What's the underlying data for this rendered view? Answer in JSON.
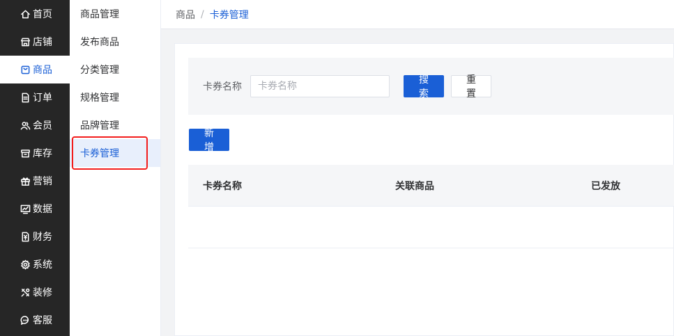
{
  "nav": {
    "items": [
      {
        "label": "首页",
        "icon": "home-icon"
      },
      {
        "label": "店铺",
        "icon": "store-icon"
      },
      {
        "label": "商品",
        "icon": "bag-icon"
      },
      {
        "label": "订单",
        "icon": "document-icon"
      },
      {
        "label": "会员",
        "icon": "users-icon"
      },
      {
        "label": "库存",
        "icon": "box-icon"
      },
      {
        "label": "营销",
        "icon": "gift-icon"
      },
      {
        "label": "数据",
        "icon": "chart-icon"
      },
      {
        "label": "财务",
        "icon": "yen-icon"
      },
      {
        "label": "系统",
        "icon": "gear-icon"
      },
      {
        "label": "装修",
        "icon": "brush-icon"
      },
      {
        "label": "客服",
        "icon": "chat-icon"
      }
    ],
    "active_index": 2
  },
  "subnav": {
    "items": [
      "商品管理",
      "发布商品",
      "分类管理",
      "规格管理",
      "品牌管理",
      "卡券管理"
    ],
    "active_index": 5
  },
  "breadcrumb": {
    "root": "商品",
    "separator": "/",
    "current": "卡券管理"
  },
  "search": {
    "label": "卡券名称",
    "placeholder": "卡券名称",
    "value": "",
    "search_button": "搜索",
    "reset_button": "重置"
  },
  "toolbar": {
    "add_button": "新增"
  },
  "table": {
    "columns": [
      "卡券名称",
      "关联商品",
      "已发放"
    ],
    "rows": []
  },
  "colors": {
    "primary": "#1a5fd6",
    "nav_bg": "#262626",
    "highlight": "#f21c1c"
  }
}
